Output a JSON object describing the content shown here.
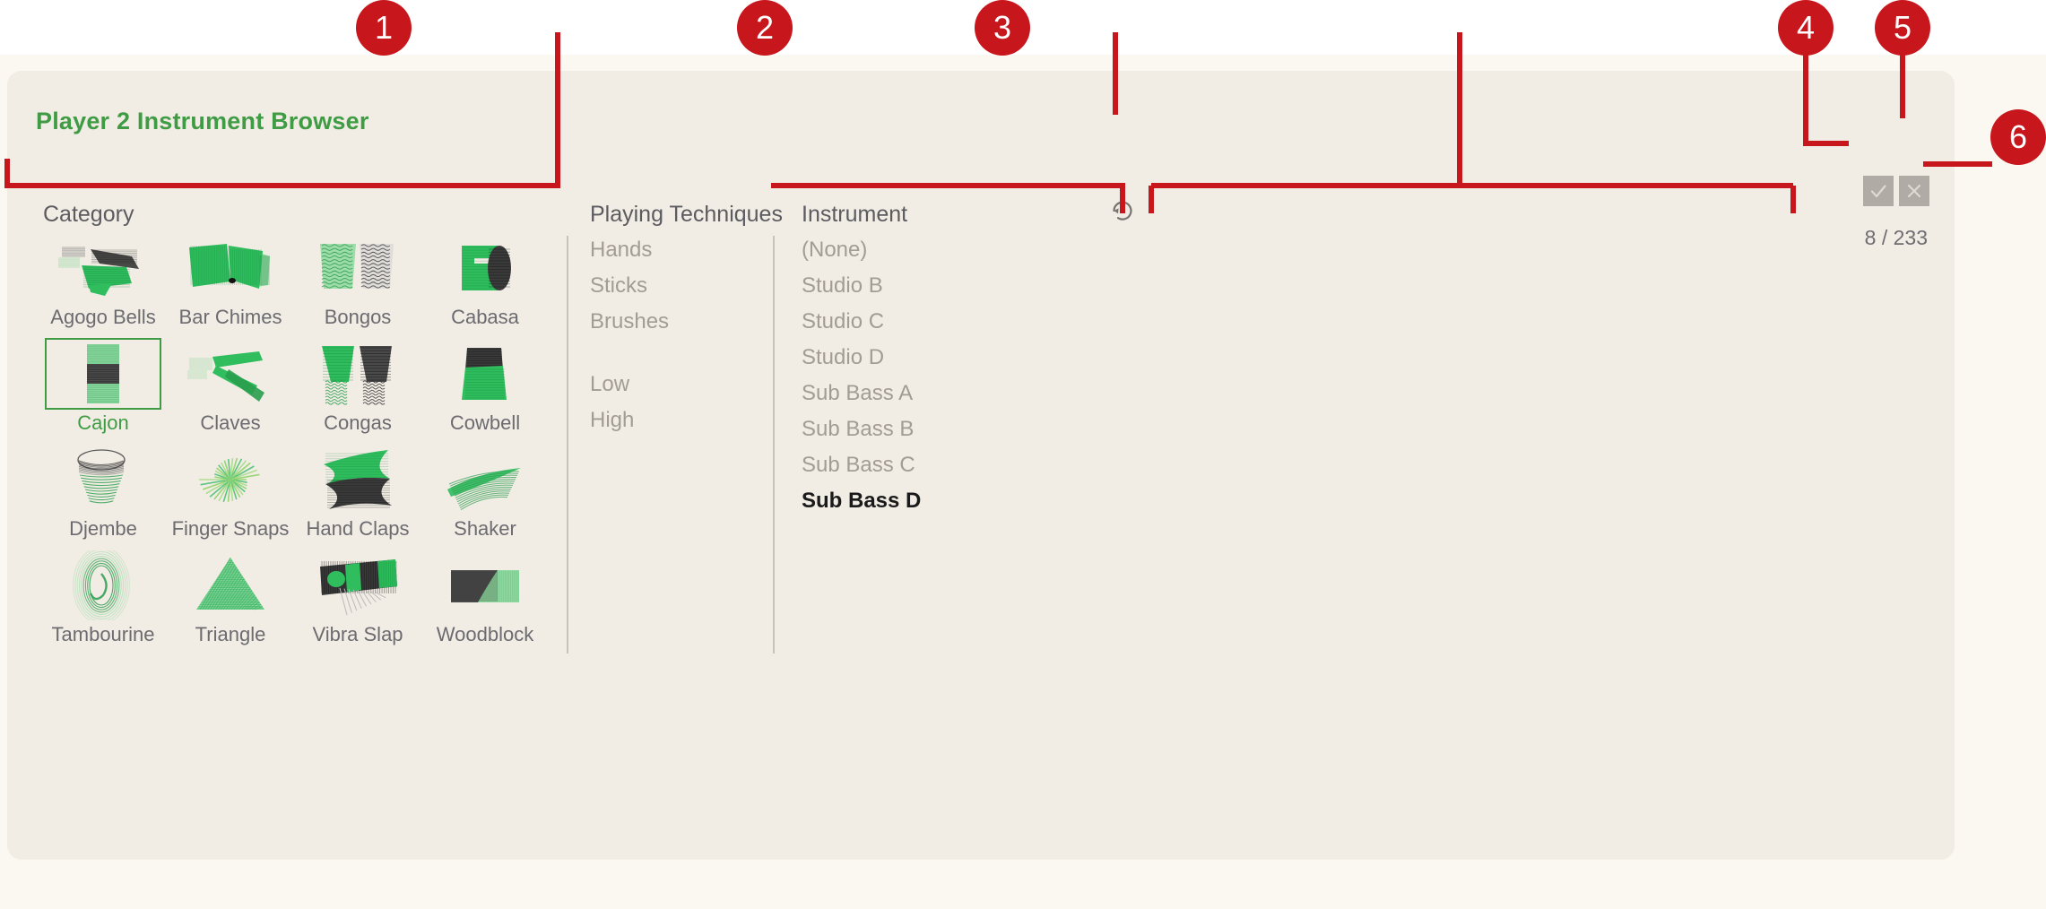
{
  "panel": {
    "title": "Player 2 Instrument Browser",
    "counter": "8 / 233",
    "reset_icon": "reset-rotate-ccw-icon",
    "confirm_icon": "checkmark-icon",
    "cancel_icon": "close-x-icon"
  },
  "columns": {
    "category_header": "Category",
    "techniques_header": "Playing Techniques",
    "instrument_header": "Instrument"
  },
  "categories": [
    {
      "label": "Agogo Bells",
      "icon": "agogo-bells-icon",
      "selected": false
    },
    {
      "label": "Bar Chimes",
      "icon": "bar-chimes-icon",
      "selected": false
    },
    {
      "label": "Bongos",
      "icon": "bongos-icon",
      "selected": false
    },
    {
      "label": "Cabasa",
      "icon": "cabasa-icon",
      "selected": false
    },
    {
      "label": "Cajon",
      "icon": "cajon-icon",
      "selected": true
    },
    {
      "label": "Claves",
      "icon": "claves-icon",
      "selected": false
    },
    {
      "label": "Congas",
      "icon": "congas-icon",
      "selected": false
    },
    {
      "label": "Cowbell",
      "icon": "cowbell-icon",
      "selected": false
    },
    {
      "label": "Djembe",
      "icon": "djembe-icon",
      "selected": false
    },
    {
      "label": "Finger Snaps",
      "icon": "finger-snaps-icon",
      "selected": false
    },
    {
      "label": "Hand Claps",
      "icon": "hand-claps-icon",
      "selected": false
    },
    {
      "label": "Shaker",
      "icon": "shaker-icon",
      "selected": false
    },
    {
      "label": "Tambourine",
      "icon": "tambourine-icon",
      "selected": false
    },
    {
      "label": "Triangle",
      "icon": "triangle-icon",
      "selected": false
    },
    {
      "label": "Vibra Slap",
      "icon": "vibra-slap-icon",
      "selected": false
    },
    {
      "label": "Woodblock",
      "icon": "woodblock-icon",
      "selected": false
    }
  ],
  "techniques": [
    {
      "label": "Hands",
      "selected": false
    },
    {
      "label": "Sticks",
      "selected": false
    },
    {
      "label": "Brushes",
      "selected": false
    },
    {
      "label": "Low",
      "selected": false
    },
    {
      "label": "High",
      "selected": false
    }
  ],
  "instruments": [
    {
      "label": "(None)",
      "selected": false
    },
    {
      "label": "Studio B",
      "selected": false
    },
    {
      "label": "Studio C",
      "selected": false
    },
    {
      "label": "Studio D",
      "selected": false
    },
    {
      "label": "Sub Bass A",
      "selected": false
    },
    {
      "label": "Sub Bass B",
      "selected": false
    },
    {
      "label": "Sub Bass C",
      "selected": false
    },
    {
      "label": "Sub Bass D",
      "selected": true
    }
  ],
  "callouts": [
    {
      "number": "1"
    },
    {
      "number": "2"
    },
    {
      "number": "3"
    },
    {
      "number": "4"
    },
    {
      "number": "5"
    },
    {
      "number": "6"
    }
  ],
  "colors": {
    "accent_green": "#3f9c45",
    "callout_red": "#c8161d",
    "panel_bg": "#f1ece4",
    "page_bg": "#fbf7f1",
    "muted_text": "#a29c94",
    "header_text": "#5b5b60"
  }
}
